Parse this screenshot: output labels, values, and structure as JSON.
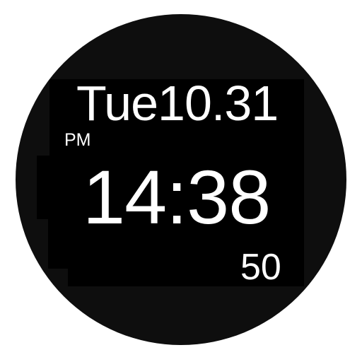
{
  "watch_face": {
    "date": "Tue10.31",
    "ampm": "PM",
    "time": "14:38",
    "seconds": "50"
  }
}
